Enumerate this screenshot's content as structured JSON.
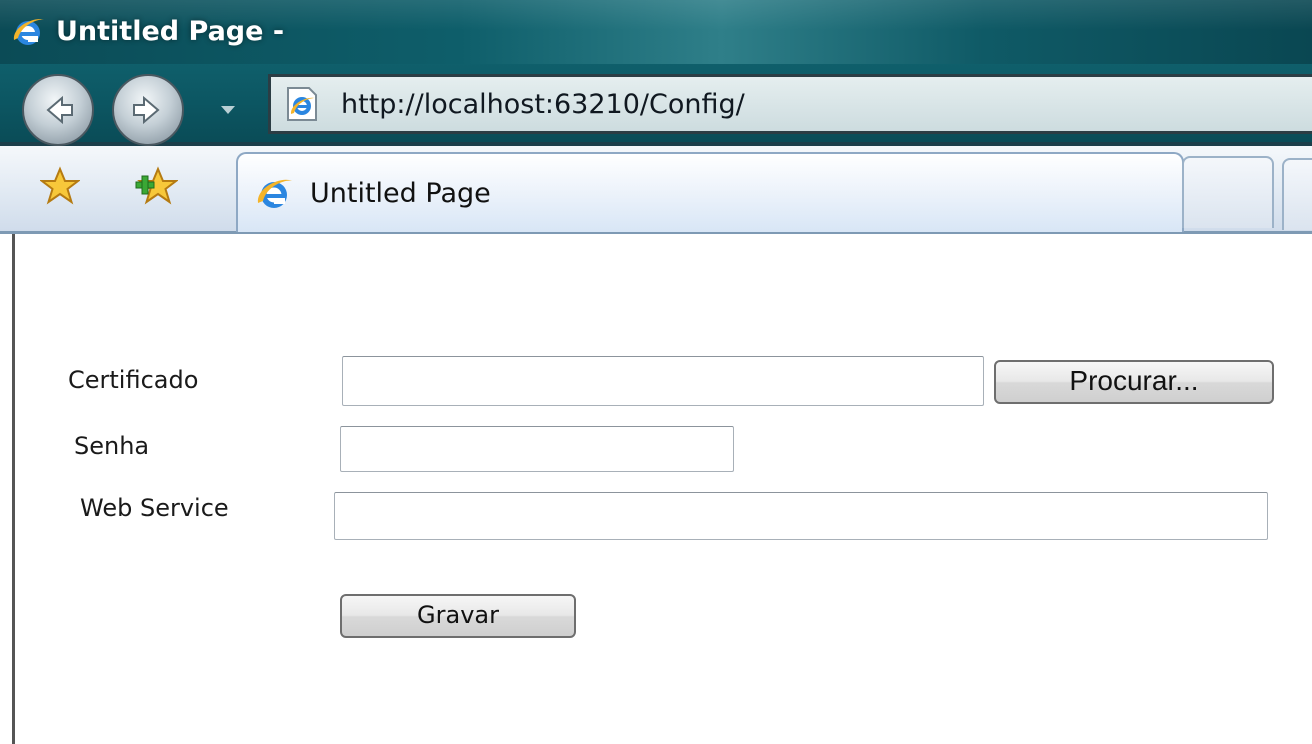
{
  "window": {
    "title": "Untitled Page -"
  },
  "nav": {
    "address": "http://localhost:63210/Config/"
  },
  "tabs": [
    {
      "label": "Untitled Page"
    }
  ],
  "form": {
    "certificado": {
      "label": "Certificado",
      "value": "",
      "browse_label": "Procurar..."
    },
    "senha": {
      "label": "Senha",
      "value": ""
    },
    "web_service": {
      "label": "Web Service",
      "value": ""
    },
    "submit_label": "Gravar"
  },
  "icons": {
    "title": "internet-explorer-icon",
    "back": "back-arrow-icon",
    "forward": "forward-arrow-icon",
    "recent": "dropdown-arrow-icon",
    "page": "ie-page-icon",
    "favorites": "favorites-star-icon",
    "add_favorites": "add-favorites-icon",
    "tab": "internet-explorer-icon"
  },
  "colors": {
    "titlebar": "#0e5e6a",
    "tab_bar": "#dfe8f2",
    "ie_blue": "#1f7fd6",
    "ie_orange": "#f2a21c"
  }
}
